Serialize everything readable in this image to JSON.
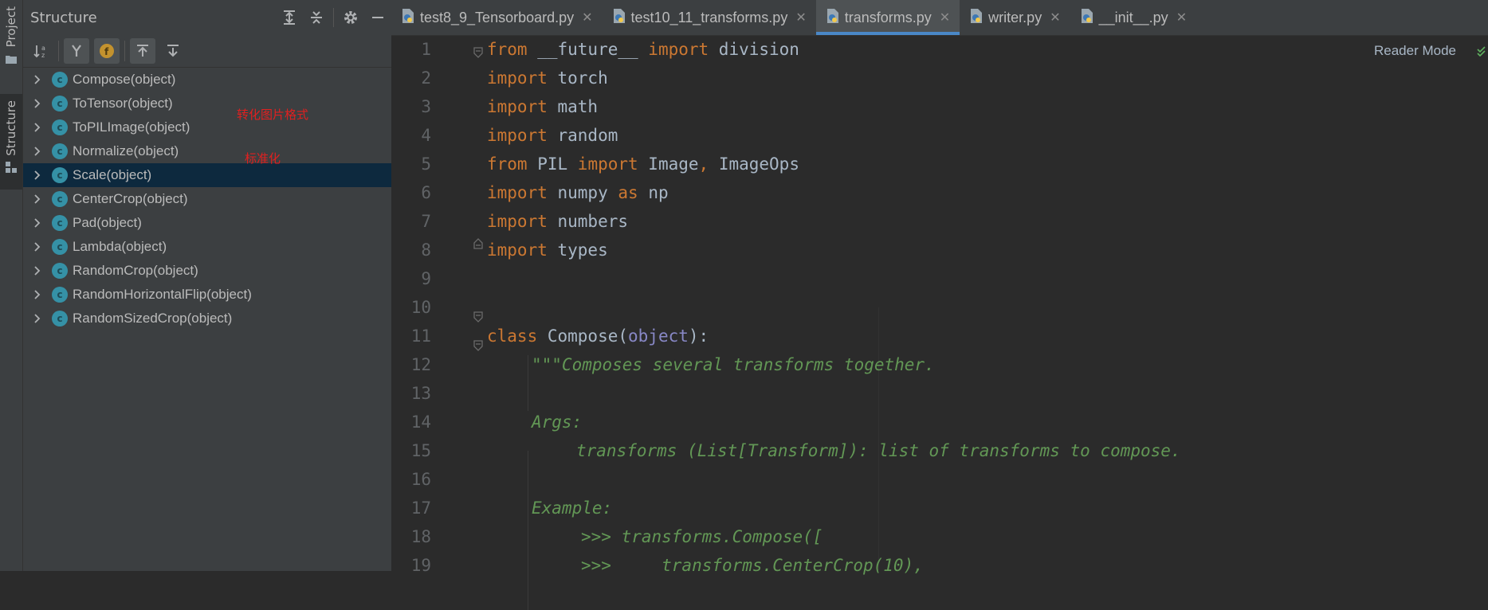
{
  "toolstrip": {
    "project_label": "Project",
    "structure_label": "Structure"
  },
  "structure": {
    "title": "Structure",
    "items": [
      {
        "label": "Compose(object)"
      },
      {
        "label": "ToTensor(object)"
      },
      {
        "label": "ToPILImage(object)"
      },
      {
        "label": "Normalize(object)"
      },
      {
        "label": "Scale(object)"
      },
      {
        "label": "CenterCrop(object)"
      },
      {
        "label": "Pad(object)"
      },
      {
        "label": "Lambda(object)"
      },
      {
        "label": "RandomCrop(object)"
      },
      {
        "label": "RandomHorizontalFlip(object)"
      },
      {
        "label": "RandomSizedCrop(object)"
      }
    ],
    "class_icon_letter": "c",
    "annotations": {
      "to_tensor_note": "转化图片格式",
      "normalize_note": "标准化"
    }
  },
  "tabs": [
    {
      "label": "test8_9_Tensorboard.py"
    },
    {
      "label": "test10_11_transforms.py"
    },
    {
      "label": "transforms.py"
    },
    {
      "label": "writer.py"
    },
    {
      "label": "__init__.py"
    }
  ],
  "editor": {
    "reader_mode": "Reader Mode",
    "line_numbers": [
      "1",
      "2",
      "3",
      "4",
      "5",
      "6",
      "7",
      "8",
      "9",
      "10",
      "11",
      "12",
      "13",
      "14",
      "15",
      "16",
      "17",
      "18",
      "19"
    ]
  },
  "code": {
    "l1": {
      "a": "from",
      "b": " __future__ ",
      "c": "import",
      "d": " division"
    },
    "l2": {
      "a": "import",
      "b": " torch"
    },
    "l3": {
      "a": "import",
      "b": " math"
    },
    "l4": {
      "a": "import",
      "b": " random"
    },
    "l5": {
      "a": "from",
      "b": " PIL ",
      "c": "import",
      "d": " Image",
      "e": ",",
      "f": " ImageOps"
    },
    "l6": {
      "a": "import",
      "b": " numpy ",
      "c": "as",
      "d": " np"
    },
    "l7": {
      "a": "import",
      "b": " numbers"
    },
    "l8": {
      "a": "import",
      "b": " types"
    },
    "l11": {
      "a": "class",
      "b": " Compose(",
      "c": "object",
      "d": "):"
    },
    "l12": "\"\"\"Composes several transforms together.",
    "l14": "Args:",
    "l15": "transforms (List[Transform]): list of transforms to compose.",
    "l17": "Example:",
    "l18": ">>> transforms.Compose([",
    "l19": ">>>     transforms.CenterCrop(10),"
  },
  "colors": {
    "keyword": "#cc7832",
    "identifier": "#a9b7c6",
    "builtin": "#8888c6",
    "docstring": "#629755",
    "selection": "#0d293e",
    "tab_underline": "#4a88c7",
    "annotation": "#e02020"
  }
}
